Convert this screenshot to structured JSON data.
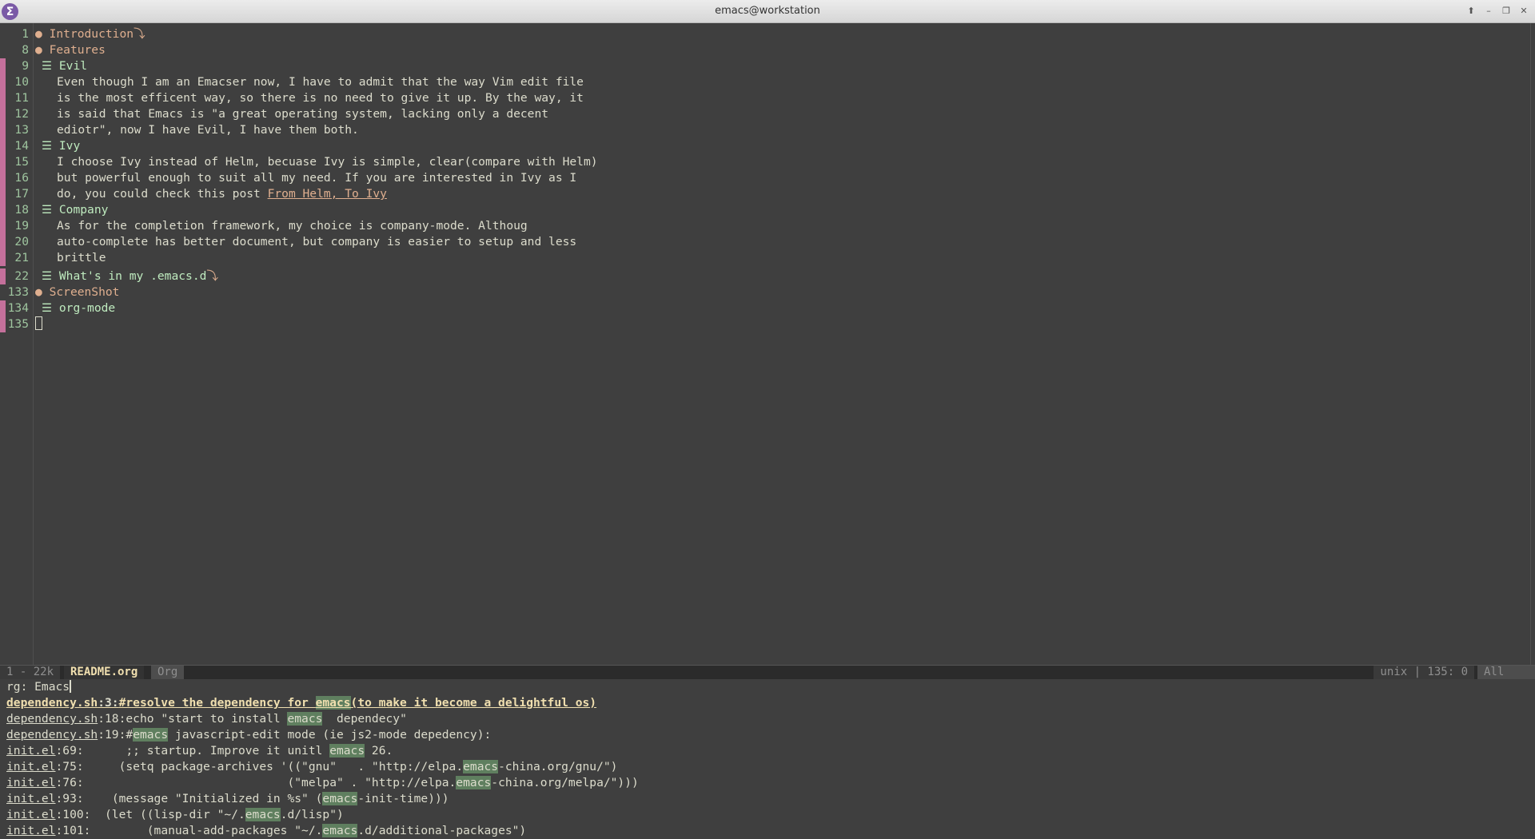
{
  "window": {
    "title": "emacs@workstation",
    "app_icon": "Σ",
    "controls": [
      "up-icon",
      "minimize-icon",
      "restore-icon",
      "close-icon"
    ]
  },
  "editor": {
    "lines": [
      {
        "num": "1",
        "level": 1,
        "bullet": "●",
        "text": "Introduction",
        "ellipsis": true
      },
      {
        "num": "8",
        "level": 1,
        "bullet": "●",
        "text": "Features"
      },
      {
        "num": "9",
        "level": 2,
        "bullet": "☰",
        "text": "Evil"
      },
      {
        "num": "10",
        "level": 0,
        "text": "Even though I am an Emacser now, I have to admit that the way Vim edit file"
      },
      {
        "num": "11",
        "level": 0,
        "text": "is the most efficent way, so there is no need to give it up. By the way, it"
      },
      {
        "num": "12",
        "level": 0,
        "text": "is said that Emacs is \"a great operating system, lacking only a decent"
      },
      {
        "num": "13",
        "level": 0,
        "text": "ediotr\", now I have Evil, I have them both."
      },
      {
        "num": "14",
        "level": 2,
        "bullet": "☰",
        "text": "Ivy"
      },
      {
        "num": "15",
        "level": 0,
        "text": "I choose Ivy instead of Helm, becuase Ivy is simple, clear(compare with Helm)"
      },
      {
        "num": "16",
        "level": 0,
        "text": "but powerful enough to suit all my need. If you are interested in Ivy as I"
      },
      {
        "num": "17",
        "level": 0,
        "text": "do, you could check this post ",
        "link": "From Helm, To Ivy"
      },
      {
        "num": "18",
        "level": 2,
        "bullet": "☰",
        "text": "Company"
      },
      {
        "num": "19",
        "level": 0,
        "text": "As for the completion framework, my choice is company-mode. Althoug"
      },
      {
        "num": "20",
        "level": 0,
        "text": "auto-complete has better document, but company is easier to setup and less"
      },
      {
        "num": "21",
        "level": 0,
        "text": "brittle"
      },
      {
        "num": "22",
        "level": 2,
        "bullet": "☰",
        "text": "What's in my .emacs.d",
        "ellipsis": true
      },
      {
        "num": "133",
        "level": 1,
        "bullet": "●",
        "text": "ScreenShot"
      },
      {
        "num": "134",
        "level": 2,
        "bullet": "☰",
        "text": "org-mode"
      },
      {
        "num": "135",
        "level": 0,
        "text": "",
        "cursor": true
      }
    ],
    "ellipsis_glyph": "⤵"
  },
  "modeline": {
    "position": "1 - 22k",
    "buffer": "README.org",
    "mode": "Org",
    "right": "unix | 135: 0",
    "scroll": "All"
  },
  "minibuffer": {
    "prompt": "rg: Emacs",
    "results": [
      {
        "file": "dependency.sh",
        "line": ":3:",
        "parts": [
          "#resolve the dependency for ",
          "emacs",
          "(to make it become a delightful os)"
        ],
        "selected": true
      },
      {
        "file": "dependency.sh",
        "line": ":18:",
        "parts": [
          "echo \"start to install ",
          "emacs",
          "  dependecy\""
        ]
      },
      {
        "file": "dependency.sh",
        "line": ":19:",
        "parts": [
          "#",
          "emacs",
          " javascript-edit mode (ie js2-mode depedency):"
        ]
      },
      {
        "file": "init.el",
        "line": ":69:",
        "parts": [
          "      ;; startup. Improve it unitl ",
          "emacs",
          " 26."
        ]
      },
      {
        "file": "init.el",
        "line": ":75:",
        "parts": [
          "     (setq package-archives '((\"gnu\"   . \"http://elpa.",
          "emacs",
          "-china.org/gnu/\")"
        ]
      },
      {
        "file": "init.el",
        "line": ":76:",
        "parts": [
          "                             (\"melpa\" . \"http://elpa.",
          "emacs",
          "-china.org/melpa/\")))"
        ]
      },
      {
        "file": "init.el",
        "line": ":93:",
        "parts": [
          "    (message \"Initialized in %s\" (",
          "emacs",
          "-init-time)))"
        ]
      },
      {
        "file": "init.el",
        "line": ":100:",
        "parts": [
          "  (let ((lisp-dir \"~/.",
          "emacs",
          ".d/lisp\")"
        ]
      },
      {
        "file": "init.el",
        "line": ":101:",
        "parts": [
          "        (manual-add-packages \"~/.",
          "emacs",
          ".d/additional-packages\")"
        ]
      }
    ]
  }
}
